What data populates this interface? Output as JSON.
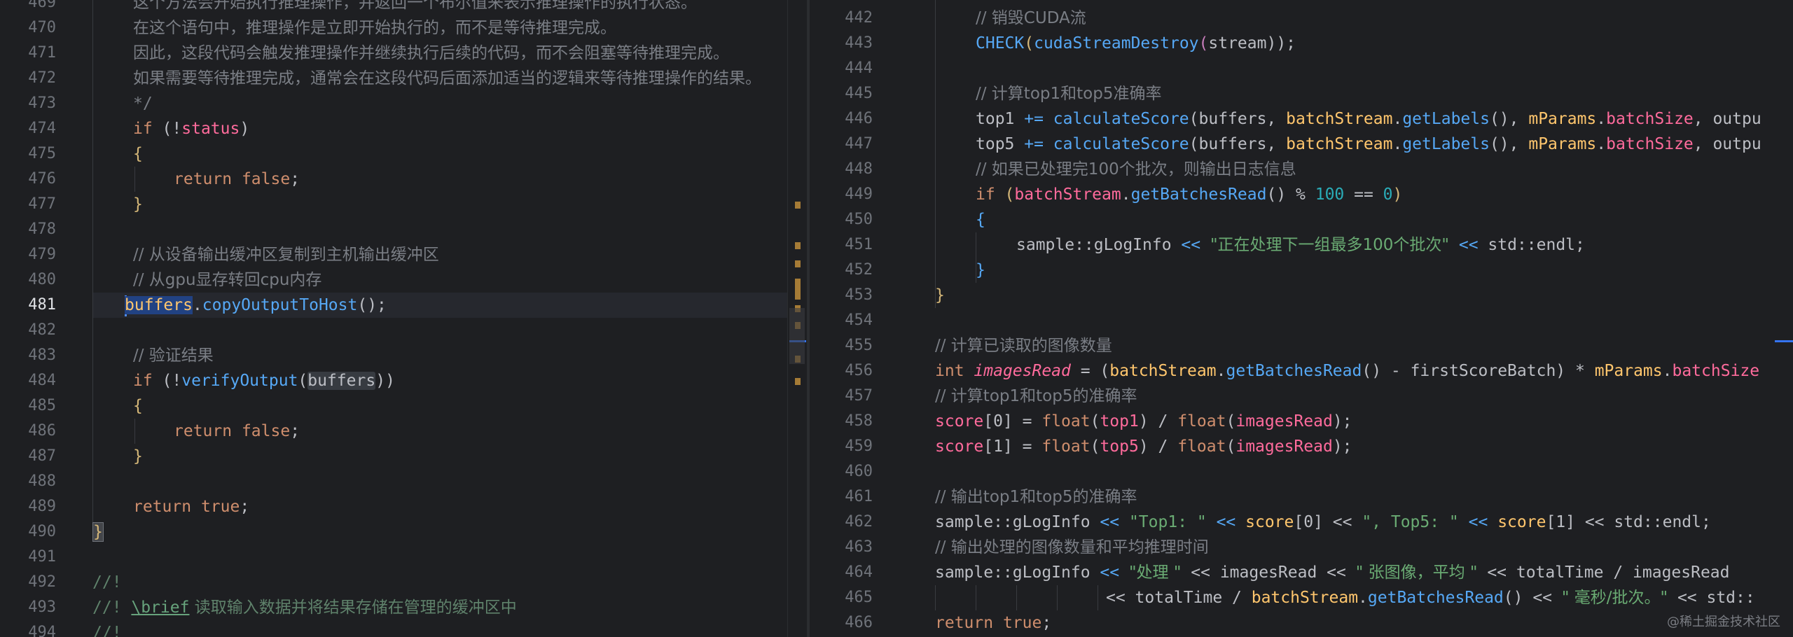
{
  "left": {
    "current_line": "481",
    "lines": [
      {
        "n": "469",
        "t": "这个方法会开始执行推理操作，并返回一个布尔值来表示推理操作的执行状态。"
      },
      {
        "n": "470",
        "t": "在这个语句中，推理操作是立即开始执行的，而不是等待推理完成。"
      },
      {
        "n": "471",
        "t": "因此，这段代码会触发推理操作并继续执行后续的代码，而不会阻塞等待推理完成。"
      },
      {
        "n": "472",
        "t": "如果需要等待推理完成，通常会在这段代码后面添加适当的逻辑来等待推理操作的结果。"
      },
      {
        "n": "473",
        "t": "*/"
      },
      {
        "n": "474",
        "t1": "if",
        "t2": " (!",
        "t3": "status",
        "t4": ")"
      },
      {
        "n": "475",
        "t": "{"
      },
      {
        "n": "476",
        "t1": "return",
        "t2": " ",
        "t3": "false",
        "t4": ";"
      },
      {
        "n": "477",
        "t": "}"
      },
      {
        "n": "478",
        "t": ""
      },
      {
        "n": "479",
        "t": "// 从设备输出缓冲区复制到主机输出缓冲区"
      },
      {
        "n": "480",
        "t": "// 从gpu显存转回cpu内存"
      },
      {
        "n": "481",
        "t1": "buffers",
        "t2": ".",
        "t3": "copyOutputToHost",
        "t4": "();"
      },
      {
        "n": "482",
        "t": ""
      },
      {
        "n": "483",
        "t": "// 验证结果"
      },
      {
        "n": "484",
        "t1": "if",
        "t2": " (!",
        "t3": "verifyOutput",
        "t4": "(",
        "t5": "buffers",
        "t6": "))"
      },
      {
        "n": "485",
        "t": "{"
      },
      {
        "n": "486",
        "t1": "return",
        "t2": " ",
        "t3": "false",
        "t4": ";"
      },
      {
        "n": "487",
        "t": "}"
      },
      {
        "n": "488",
        "t": ""
      },
      {
        "n": "489",
        "t1": "return",
        "t2": " ",
        "t3": "true",
        "t4": ";"
      },
      {
        "n": "490",
        "t": "}"
      },
      {
        "n": "491",
        "t": ""
      },
      {
        "n": "492",
        "t": "//!"
      },
      {
        "n": "493",
        "t1": "//! ",
        "t2": "\\brief",
        "t3": " 读取输入数据并将结果存储在管理的缓冲区中"
      },
      {
        "n": "494",
        "t": "//!"
      }
    ]
  },
  "right": {
    "lines": [
      {
        "n": "442",
        "t": "// 销毁CUDA流"
      },
      {
        "n": "443",
        "a": "CHECK",
        "b": "(",
        "c": "cudaStreamDestroy",
        "d": "(",
        "e": "stream",
        "f": "));"
      },
      {
        "n": "444",
        "t": ""
      },
      {
        "n": "445",
        "t": "// 计算top1和top5准确率"
      },
      {
        "n": "446",
        "a": "top1",
        "b": " += ",
        "c": "calculateScore",
        "d": "(buffers, ",
        "e": "batchStream",
        "f": ".",
        "g": "getLabels",
        "h": "(), ",
        "i": "mParams",
        "j": ".",
        "k": "batchSize",
        "l": ", outpu"
      },
      {
        "n": "447",
        "a": "top5",
        "b": " += ",
        "c": "calculateScore",
        "d": "(buffers, ",
        "e": "batchStream",
        "f": ".",
        "g": "getLabels",
        "h": "(), ",
        "i": "mParams",
        "j": ".",
        "k": "batchSize",
        "l": ", outpu"
      },
      {
        "n": "448",
        "t": "// 如果已处理完100个批次，则输出日志信息"
      },
      {
        "n": "449",
        "a": "if",
        "b": " (",
        "c": "batchStream",
        "d": ".",
        "e": "getBatchesRead",
        "f": "() % ",
        "g": "100",
        "h": " == ",
        "i": "0",
        "j": ")"
      },
      {
        "n": "450",
        "t": "{"
      },
      {
        "n": "451",
        "a": "sample::gLogInfo",
        "b": " << ",
        "c": "\"正在处理下一组最多100个批次\"",
        "d": " << ",
        "e": "std::endl;"
      },
      {
        "n": "452",
        "t": "}"
      },
      {
        "n": "453",
        "t": "}"
      },
      {
        "n": "454",
        "t": ""
      },
      {
        "n": "455",
        "t": "// 计算已读取的图像数量"
      },
      {
        "n": "456",
        "a": "int",
        "b": " ",
        "c": "imagesRead",
        "d": " = (",
        "e": "batchStream",
        "f": ".",
        "g": "getBatchesRead",
        "h": "() - firstScoreBatch) * ",
        "i": "mParams",
        "j": ".",
        "k": "batchSize"
      },
      {
        "n": "457",
        "t": "// 计算top1和top5的准确率"
      },
      {
        "n": "458",
        "a": "score",
        "b": "[0] = ",
        "c": "float",
        "d": "(",
        "e": "top1",
        "f": ") / ",
        "g": "float",
        "h": "(",
        "i": "imagesRead",
        "j": ");"
      },
      {
        "n": "459",
        "a": "score",
        "b": "[1] = ",
        "c": "float",
        "d": "(",
        "e": "top5",
        "f": ") / ",
        "g": "float",
        "h": "(",
        "i": "imagesRead",
        "j": ");"
      },
      {
        "n": "460",
        "t": ""
      },
      {
        "n": "461",
        "t": "// 输出top1和top5的准确率"
      },
      {
        "n": "462",
        "a": "sample::gLogInfo",
        "b": " << ",
        "c": "\"Top1: \"",
        "d": " << ",
        "e": "score",
        "f": "[0] << ",
        "g": "\", Top5: \"",
        "h": " << ",
        "i": "score",
        "j": "[1] << std::endl;"
      },
      {
        "n": "463",
        "t": "// 输出处理的图像数量和平均推理时间"
      },
      {
        "n": "464",
        "a": "sample::gLogInfo",
        "b": " << ",
        "c": "\"处理 \"",
        "d": " << imagesRead << ",
        "e": "\" 张图像，平均 \"",
        "f": " << totalTime / imagesRead"
      },
      {
        "n": "465",
        "a": "<< totalTime / ",
        "b": "batchStream",
        "c": ".",
        "d": "getBatchesRead",
        "e": "() << ",
        "f": "\" 毫秒/批次。\"",
        "g": " << std::"
      },
      {
        "n": "466",
        "a": "return",
        "b": " ",
        "c": "true",
        "d": ";"
      }
    ]
  },
  "watermark": "@稀土掘金技术社区"
}
